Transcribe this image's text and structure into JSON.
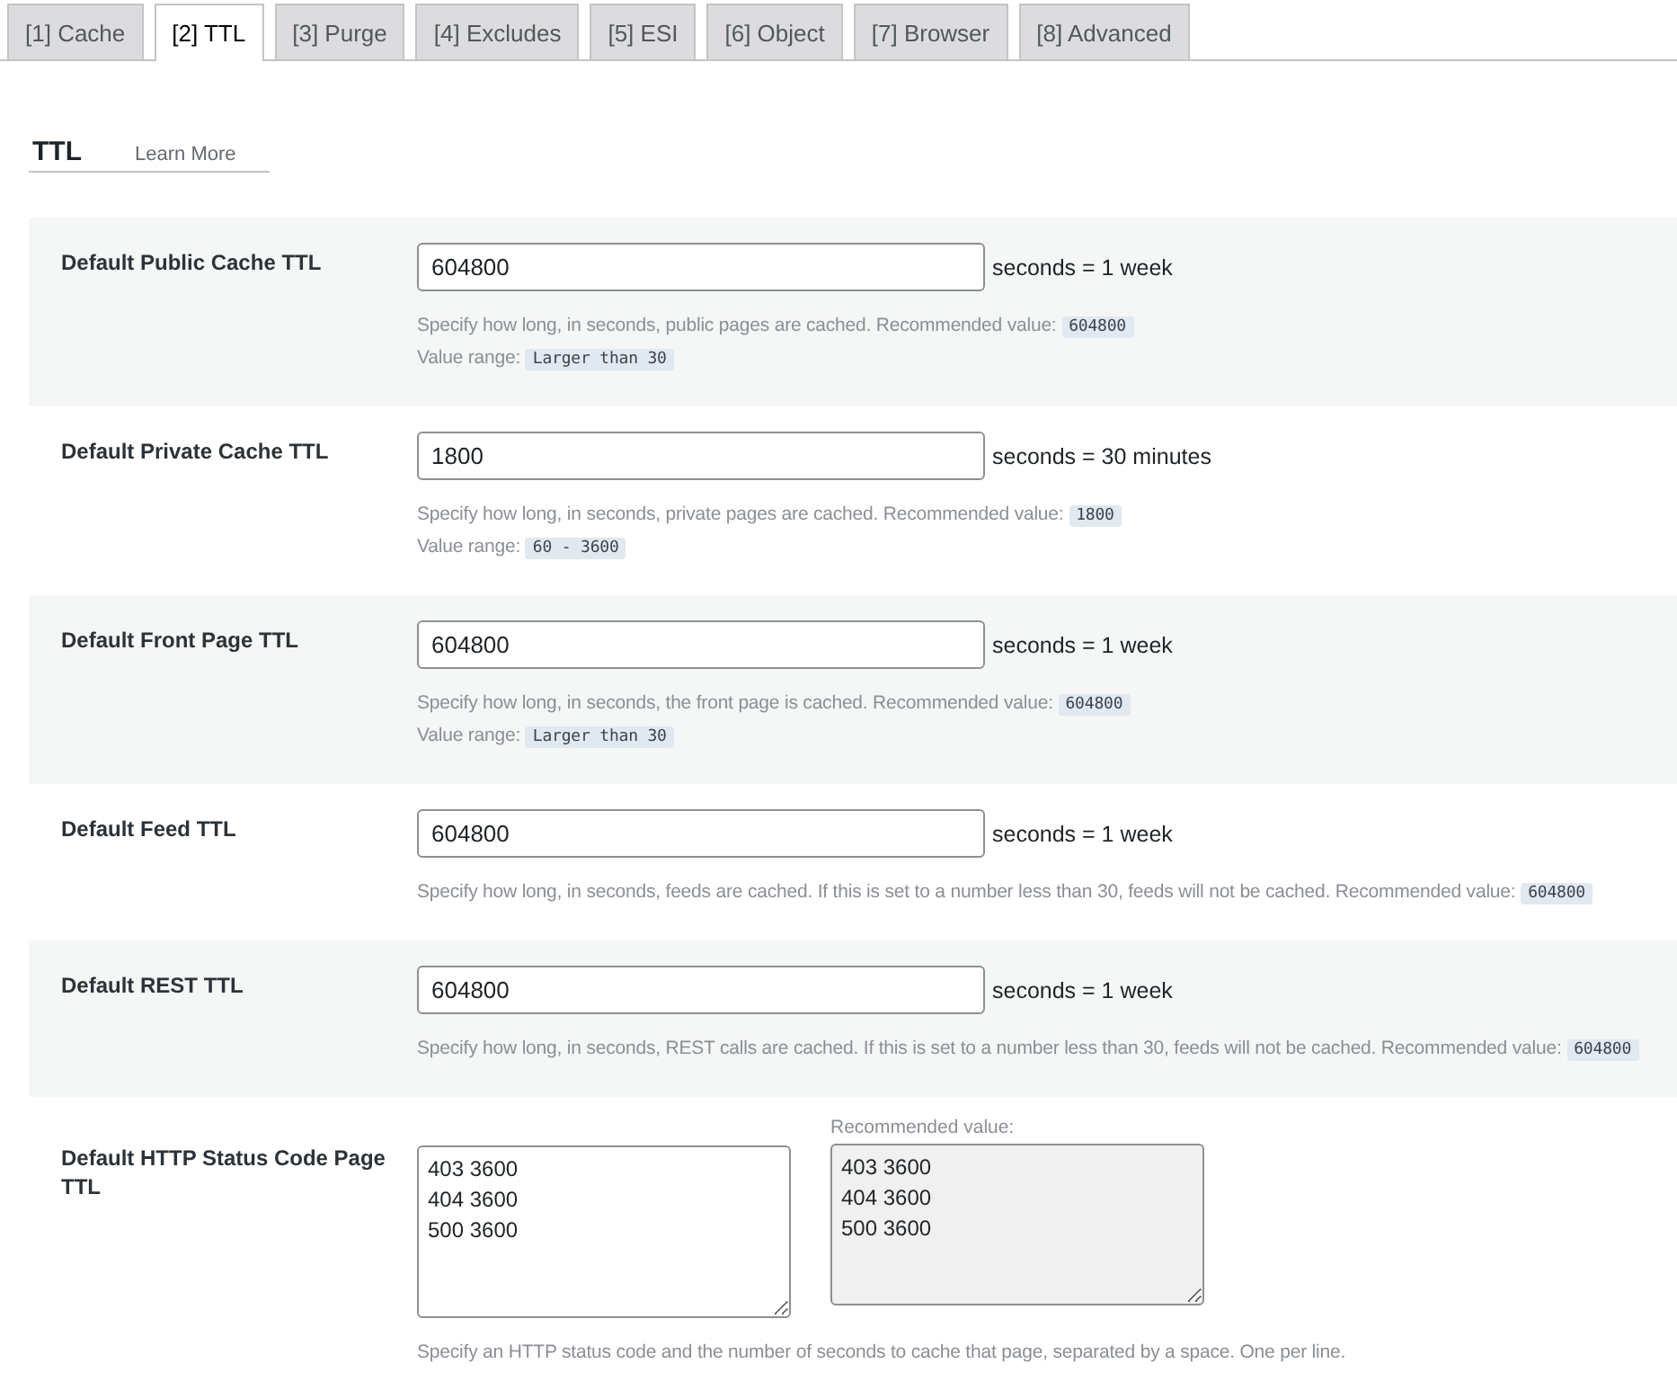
{
  "tabs": [
    {
      "label": "[1] Cache",
      "selected": false
    },
    {
      "label": "[2] TTL",
      "selected": true
    },
    {
      "label": "[3] Purge",
      "selected": false
    },
    {
      "label": "[4] Excludes",
      "selected": false
    },
    {
      "label": "[5] ESI",
      "selected": false
    },
    {
      "label": "[6] Object",
      "selected": false
    },
    {
      "label": "[7] Browser",
      "selected": false
    },
    {
      "label": "[8] Advanced",
      "selected": false
    }
  ],
  "section": {
    "title": "TTL",
    "link": "Learn More"
  },
  "settings": [
    {
      "kind": "input",
      "label": "Default Public Cache TTL",
      "value": "604800",
      "unit": "seconds = 1 week",
      "description": [
        {
          "text": "Specify how long, in seconds, public pages are cached. Recommended value:",
          "code": "604800"
        },
        {
          "text": "Value range:",
          "code": "Larger than 30"
        }
      ]
    },
    {
      "kind": "input",
      "label": "Default Private Cache TTL",
      "value": "1800",
      "unit": "seconds = 30 minutes",
      "description": [
        {
          "text": "Specify how long, in seconds, private pages are cached. Recommended value:",
          "code": "1800"
        },
        {
          "text": "Value range:",
          "code": "60 - 3600"
        }
      ]
    },
    {
      "kind": "input",
      "label": "Default Front Page TTL",
      "value": "604800",
      "unit": "seconds = 1 week",
      "description": [
        {
          "text": "Specify how long, in seconds, the front page is cached. Recommended value:",
          "code": "604800"
        },
        {
          "text": "Value range:",
          "code": "Larger than 30"
        }
      ]
    },
    {
      "kind": "input",
      "label": "Default Feed TTL",
      "value": "604800",
      "unit": "seconds = 1 week",
      "description": [
        {
          "text": "Specify how long, in seconds, feeds are cached. If this is set to a number less than 30, feeds will not be cached. Recommended value:",
          "code": "604800"
        }
      ]
    },
    {
      "kind": "input",
      "label": "Default REST TTL",
      "value": "604800",
      "unit": "seconds = 1 week",
      "description": [
        {
          "text": "Specify how long, in seconds, REST calls are cached. If this is set to a number less than 30, feeds will not be cached. Recommended value:",
          "code": "604800"
        }
      ]
    },
    {
      "kind": "textarea",
      "label": "Default HTTP Status Code Page TTL",
      "value": [
        "403 3600",
        "404 3600",
        "500 3600"
      ],
      "recommended_label": "Recommended value:",
      "recommended": [
        "403 3600",
        "404 3600",
        "500 3600"
      ],
      "description": [
        {
          "text": "Specify an HTTP status code and the number of seconds to cache that page, separated by a space. One per line."
        }
      ]
    }
  ]
}
